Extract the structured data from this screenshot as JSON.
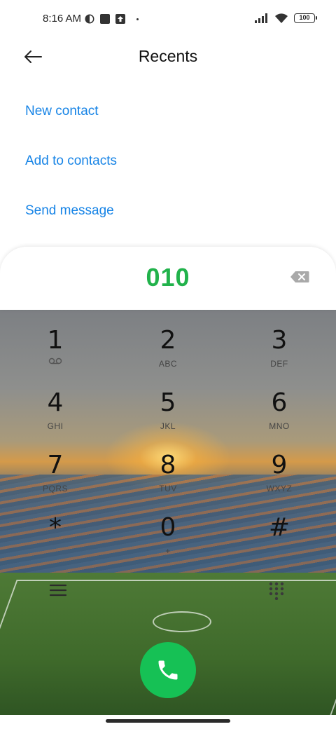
{
  "status_bar": {
    "time": "8:16 AM",
    "battery": "100"
  },
  "header": {
    "title": "Recents",
    "back_icon": "back-arrow-icon"
  },
  "actions": {
    "new_contact": "New contact",
    "add_to_contacts": "Add to contacts",
    "send_message": "Send message"
  },
  "dialer": {
    "number": "010",
    "accent_color": "#21b24b",
    "keys": [
      {
        "digit": "1",
        "letters": ""
      },
      {
        "digit": "2",
        "letters": "ABC"
      },
      {
        "digit": "3",
        "letters": "DEF"
      },
      {
        "digit": "4",
        "letters": "GHI"
      },
      {
        "digit": "5",
        "letters": "JKL"
      },
      {
        "digit": "6",
        "letters": "MNO"
      },
      {
        "digit": "7",
        "letters": "PQRS"
      },
      {
        "digit": "8",
        "letters": "TUV"
      },
      {
        "digit": "9",
        "letters": "WXYZ"
      },
      {
        "digit": "*",
        "letters": ""
      },
      {
        "digit": "0",
        "letters": "+"
      },
      {
        "digit": "#",
        "letters": ""
      }
    ],
    "call_color": "#16c155"
  },
  "colors": {
    "link": "#1784e6"
  }
}
